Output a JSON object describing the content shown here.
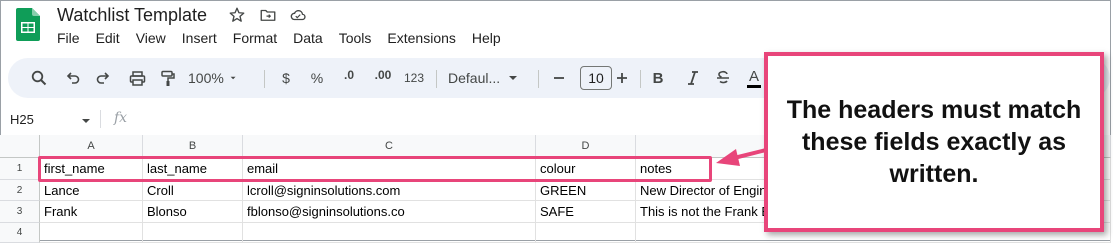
{
  "app": {
    "title": "Watchlist Template",
    "menu": [
      "File",
      "Edit",
      "View",
      "Insert",
      "Format",
      "Data",
      "Tools",
      "Extensions",
      "Help"
    ]
  },
  "toolbar": {
    "zoom": "100%",
    "currency": "$",
    "percent": "%",
    "decrease_decimal": ".0",
    "increase_decimal": ".00",
    "number_format": "123",
    "font": "Defaul...",
    "font_size": "10",
    "bold": "B",
    "text_color": "A",
    "icons": [
      "search-icon",
      "undo-icon",
      "redo-icon",
      "print-icon",
      "paint-format-icon",
      "minus-icon",
      "plus-icon",
      "strikethrough-icon"
    ]
  },
  "formula_bar": {
    "cell_ref": "H25",
    "fx": "fx"
  },
  "sheet": {
    "columns": [
      "A",
      "B",
      "C",
      "D",
      "E"
    ],
    "rows": [
      "1",
      "2",
      "3",
      "4"
    ],
    "cells": [
      [
        "first_name",
        "last_name",
        "email",
        "colour",
        "notes"
      ],
      [
        "Lance",
        "Croll",
        "lcroll@signinsolutions.com",
        "GREEN",
        "New Director of Engineering"
      ],
      [
        "Frank",
        "Blonso",
        "fblonso@signinsolutions.co",
        "SAFE",
        "This is not the Frank Blonso of the Blonso Group"
      ],
      [
        "",
        "",
        "",
        "",
        ""
      ]
    ]
  },
  "callout": {
    "text": "The headers must match these fields exactly as written."
  },
  "colors": {
    "accent": "#e8457a",
    "sheets_green": "#0f9d58",
    "toolbar_bg": "#eef2f9"
  }
}
